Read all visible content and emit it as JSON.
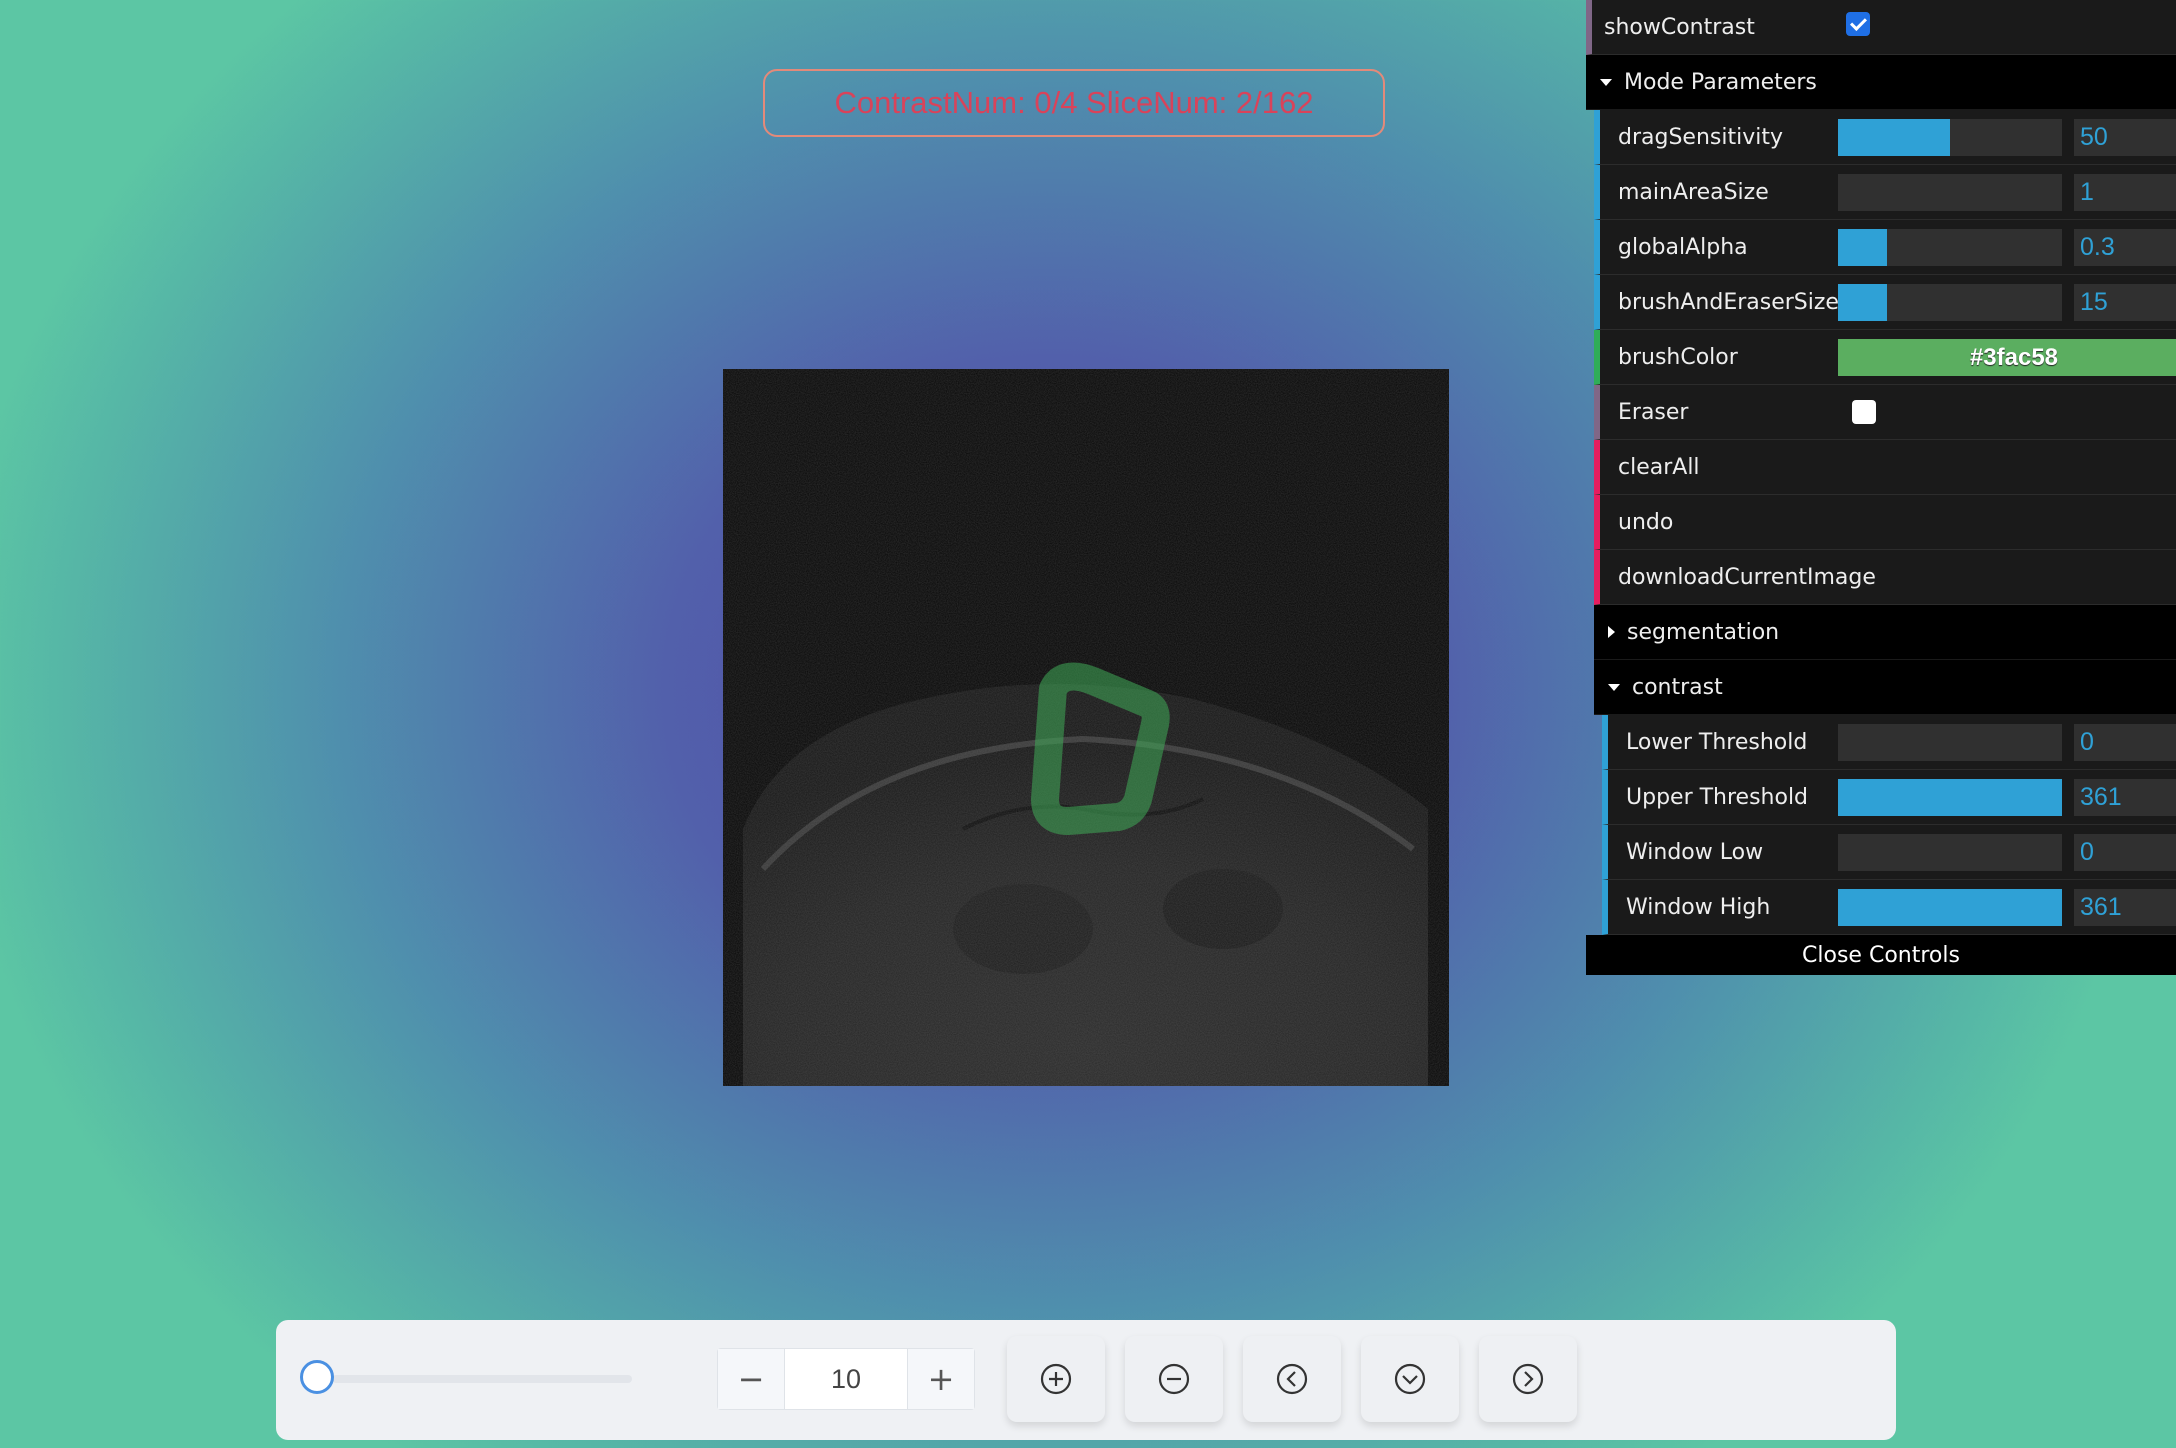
{
  "status": {
    "text": "ContrastNum: 0/4 SliceNum: 2/162"
  },
  "gui": {
    "show_contrast": {
      "label": "showContrast",
      "checked": true
    },
    "mode_parameters": {
      "title": "Mode Parameters",
      "drag_sensitivity": {
        "label": "dragSensitivity",
        "value": "50",
        "fill_fraction": 0.5
      },
      "main_area_size": {
        "label": "mainAreaSize",
        "value": "1",
        "fill_fraction": 0.0
      },
      "global_alpha": {
        "label": "globalAlpha",
        "value": "0.3",
        "fill_fraction": 0.22
      },
      "brush_size": {
        "label": "brushAndEraserSize",
        "value": "15",
        "fill_fraction": 0.22
      },
      "brush_color": {
        "label": "brushColor",
        "value": "#3fac58"
      },
      "eraser": {
        "label": "Eraser",
        "checked": false
      },
      "clear_all": {
        "label": "clearAll"
      },
      "undo": {
        "label": "undo"
      },
      "download": {
        "label": "downloadCurrentImage"
      },
      "segmentation": {
        "title": "segmentation"
      },
      "contrast": {
        "title": "contrast",
        "lower_threshold": {
          "label": "Lower Threshold",
          "value": "0",
          "fill_fraction": 0.0
        },
        "upper_threshold": {
          "label": "Upper Threshold",
          "value": "361",
          "fill_fraction": 1.0
        },
        "window_low": {
          "label": "Window Low",
          "value": "0",
          "fill_fraction": 0.0
        },
        "window_high": {
          "label": "Window High",
          "value": "361",
          "fill_fraction": 1.0
        }
      }
    },
    "close_label": "Close Controls"
  },
  "toolbar": {
    "slider_fraction": 0.0,
    "stepper": {
      "minus": "−",
      "value": "10",
      "plus": "+"
    },
    "buttons": [
      {
        "name": "zoom-in-icon"
      },
      {
        "name": "zoom-out-icon"
      },
      {
        "name": "previous-icon"
      },
      {
        "name": "down-icon"
      },
      {
        "name": "next-icon"
      }
    ]
  },
  "colors": {
    "accent": "#2fa1d6",
    "brush": "#3fac58",
    "status_text": "#d9435a"
  }
}
